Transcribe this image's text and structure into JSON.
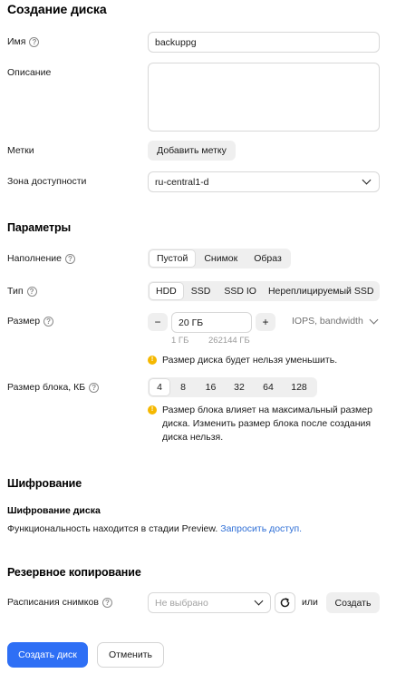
{
  "page": {
    "title": "Создание диска",
    "name_label": "Имя",
    "name_value": "backuppg",
    "description_label": "Описание",
    "description_value": "",
    "labels_label": "Метки",
    "add_label_button": "Добавить метку",
    "zone_label": "Зона доступности",
    "zone_value": "ru-central1-d"
  },
  "params": {
    "title": "Параметры",
    "fill_label": "Наполнение",
    "fill_options": [
      "Пустой",
      "Снимок",
      "Образ"
    ],
    "fill_selected": "Пустой",
    "type_label": "Тип",
    "type_options": [
      "HDD",
      "SSD",
      "SSD IO",
      "Нереплицируемый SSD"
    ],
    "type_selected": "HDD",
    "size_label": "Размер",
    "size_minus": "−",
    "size_value": "20 ГБ",
    "size_plus": "+",
    "iops_toggle": "IOPS, bandwidth",
    "size_min": "1 ГБ",
    "size_max": "262144 ГБ",
    "size_warning": "Размер диска будет нельзя уменьшить.",
    "block_label": "Размер блока, КБ",
    "block_options": [
      "4",
      "8",
      "16",
      "32",
      "64",
      "128"
    ],
    "block_selected": "4",
    "block_warning": "Размер блока влияет на максимальный размер диска. Изменить размер блока после создания диска нельзя."
  },
  "encryption": {
    "title": "Шифрование",
    "subtitle": "Шифрование диска",
    "text": "Функциональность находится в стадии Preview.",
    "link": "Запросить доступ."
  },
  "backup": {
    "title": "Резервное копирование",
    "schedule_label": "Расписания снимков",
    "schedule_placeholder": "Не выбрано",
    "or_text": "или",
    "create_button": "Создать"
  },
  "footer": {
    "submit": "Создать диск",
    "cancel": "Отменить"
  }
}
